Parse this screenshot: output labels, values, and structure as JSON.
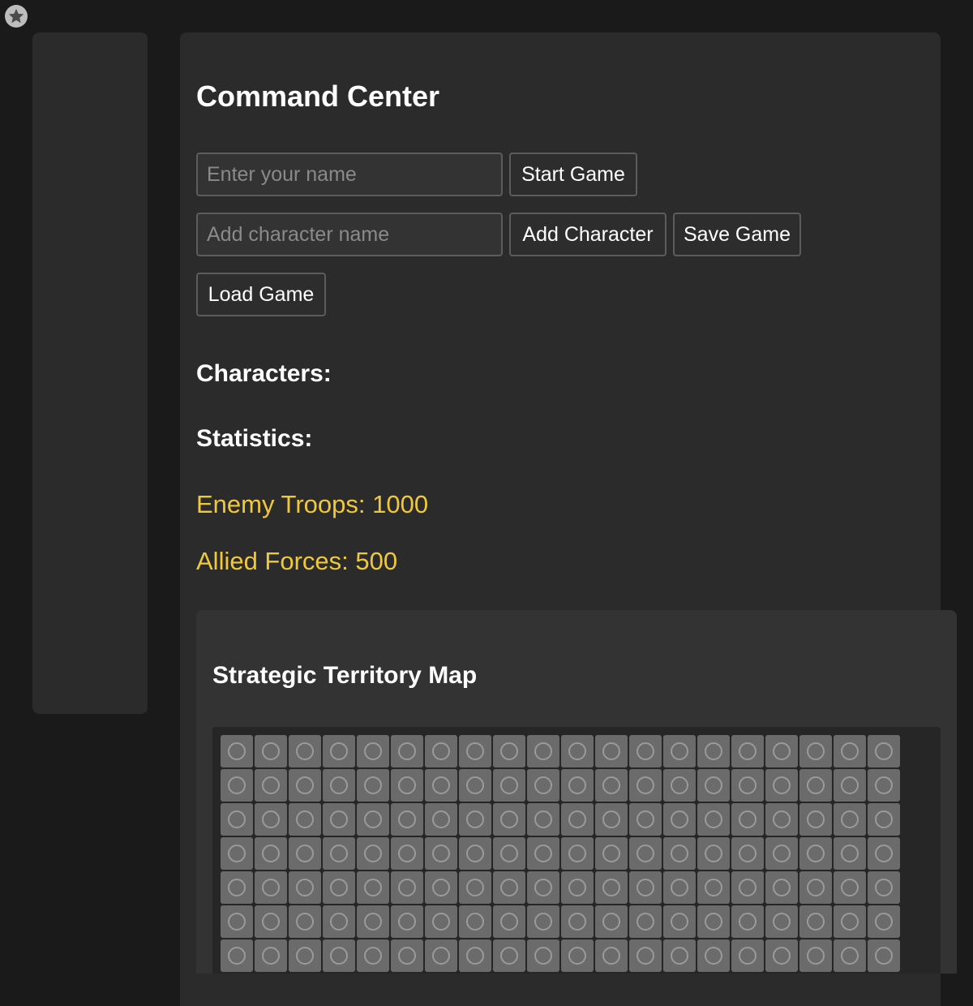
{
  "app": {
    "icon": "star-badge-icon"
  },
  "main": {
    "title": "Command Center",
    "name_input": {
      "placeholder": "Enter your name",
      "value": ""
    },
    "start_button": "Start Game",
    "character_input": {
      "placeholder": "Add character name",
      "value": ""
    },
    "add_character_button": "Add Character",
    "save_button": "Save Game",
    "load_button": "Load Game",
    "characters_heading": "Characters:",
    "characters": [],
    "statistics_heading": "Statistics:",
    "stats": {
      "enemy_troops": "Enemy Troops: 1000",
      "allied_forces": "Allied Forces: 500"
    },
    "stat_color": "#f0c83c"
  },
  "map": {
    "title": "Strategic Territory Map",
    "columns": 20,
    "visible_rows": 7,
    "tile_icon": "circle-marker-icon",
    "tile_color": "#6b6b6b"
  }
}
